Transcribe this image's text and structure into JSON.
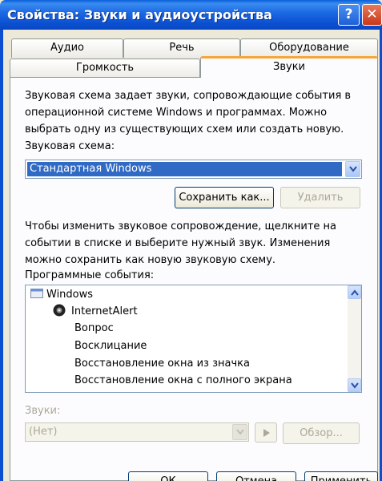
{
  "window": {
    "title": "Свойства: Звуки и аудиоустройства"
  },
  "title_buttons": {
    "help": "?",
    "close": "✕"
  },
  "tabs": {
    "row1": [
      "Аудио",
      "Речь",
      "Оборудование"
    ],
    "row2": [
      "Громкость",
      "Звуки"
    ],
    "active": "Звуки"
  },
  "intro": {
    "lines": [
      "Звуковая схема задает звуки, сопровождающие события в",
      "операционной системе Windows и программах. Можно",
      "выбрать одну из существующих схем или создать новую."
    ]
  },
  "scheme": {
    "label": "Звуковая схема:",
    "value": "Стандартная Windows",
    "save_as": "Сохранить как...",
    "delete": "Удалить"
  },
  "info": {
    "lines": [
      "Чтобы изменить звуковое сопровождение, щелкните на",
      "событии в списке и выберите нужный звук. Изменения",
      "можно сохранить как новую звуковую схему."
    ]
  },
  "events": {
    "label": "Программные события:",
    "items": [
      "Windows",
      "InternetAlert",
      "Вопрос",
      "Восклицание",
      "Восстановление окна из значка",
      "Восстановление окна с полного экрана"
    ]
  },
  "sounds": {
    "label": "Звуки:",
    "value": "(Нет)",
    "browse": "Обзор..."
  },
  "dialog_buttons": {
    "ok": "ОК",
    "cancel": "Отмена",
    "apply": "Применить"
  },
  "colors": {
    "titlebar": "#0b4fd0",
    "selection": "#316ac5",
    "active_tab_accent": "#f5a63a"
  }
}
